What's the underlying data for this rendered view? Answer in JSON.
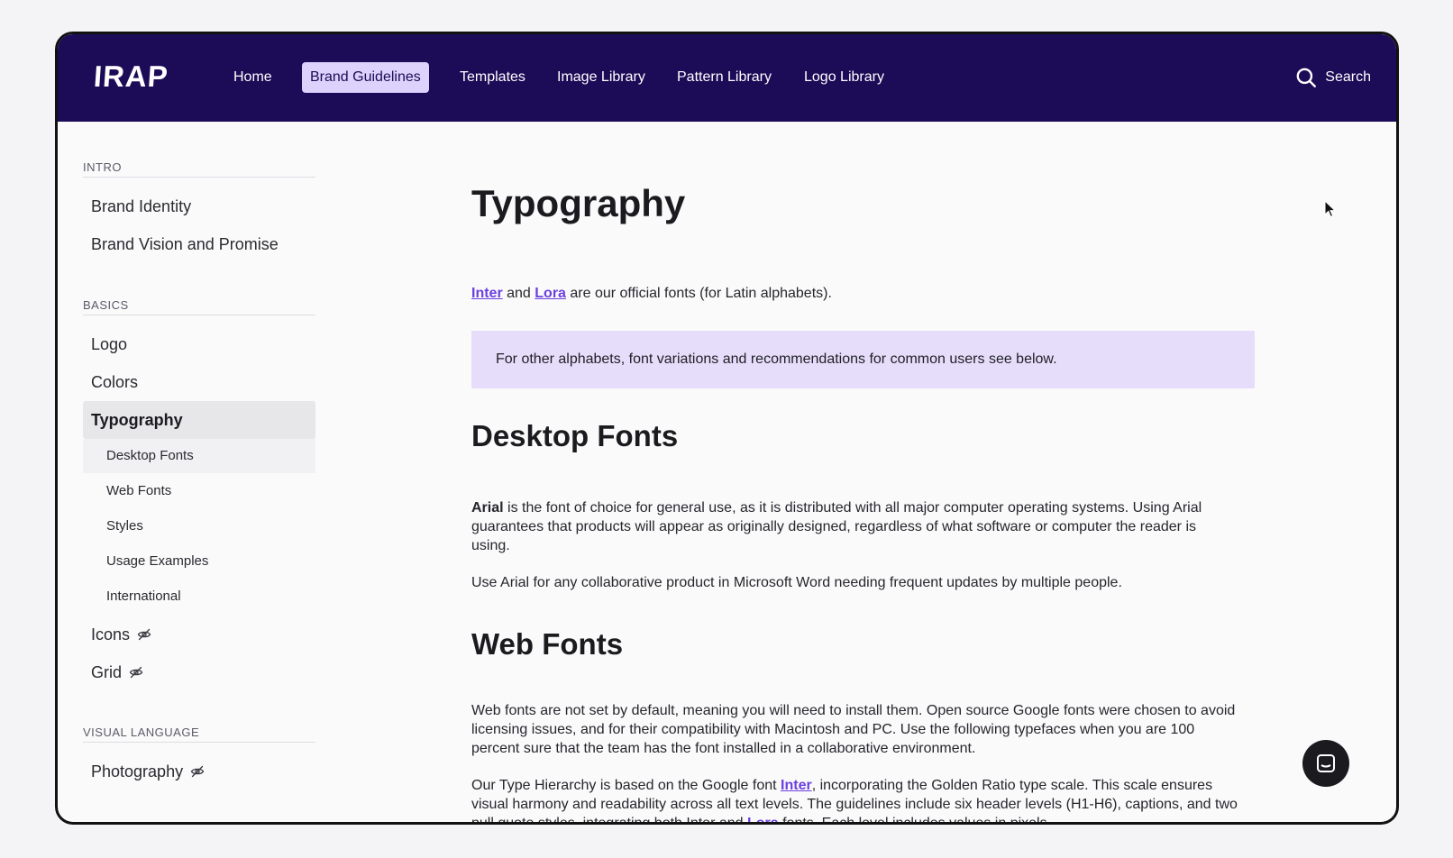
{
  "brand": {
    "logo": "IRAP"
  },
  "nav": {
    "items": [
      {
        "label": "Home",
        "active": false
      },
      {
        "label": "Brand Guidelines",
        "active": true
      },
      {
        "label": "Templates",
        "active": false
      },
      {
        "label": "Image Library",
        "active": false
      },
      {
        "label": "Pattern Library",
        "active": false
      },
      {
        "label": "Logo Library",
        "active": false
      }
    ],
    "search_label": "Search"
  },
  "sidebar": {
    "sections": [
      {
        "label": "INTRO",
        "items": [
          "Brand Identity",
          "Brand Vision and Promise"
        ]
      },
      {
        "label": "BASICS",
        "items": [
          "Logo",
          "Colors",
          "Typography"
        ],
        "subitems": [
          "Desktop Fonts",
          "Web Fonts",
          "Styles",
          "Usage Examples",
          "International"
        ],
        "more": [
          "Icons",
          "Grid"
        ]
      },
      {
        "label": "VISUAL LANGUAGE",
        "items": [
          "Photography"
        ]
      }
    ]
  },
  "content": {
    "title": "Typography",
    "intro": {
      "link1": "Inter",
      "mid": " and ",
      "link2": "Lora",
      "rest": " are our official fonts (for Latin alphabets)."
    },
    "callout": "For other alphabets, font variations and recommendations for common users see below.",
    "desktop": {
      "heading": "Desktop Fonts",
      "p1_bold": "Arial",
      "p1_rest": " is the font of choice for general use, as it is distributed with all major computer operating systems. Using Arial guarantees that products will appear as originally designed, regardless of what software or computer the reader is using.",
      "p2": "Use Arial for any collaborative product in Microsoft Word needing frequent updates by multiple people."
    },
    "web": {
      "heading": "Web Fonts",
      "p1": "Web fonts are not set by default, meaning you will need to install them. Open source Google fonts were chosen to avoid licensing issues, and for their compatibility with Macintosh and PC. Use the following typefaces when you are 100 percent sure that the team has the font installed in a collaborative environment.",
      "p2_a": "Our Type Hierarchy is based on the Google font ",
      "p2_link1": "Inter",
      "p2_b": ", incorporating the Golden Ratio type scale. This scale ensures visual harmony and readability across all text levels. The guidelines include six header levels (H1-H6), captions, and two pull quote styles, integrating both Inter and ",
      "p2_link2": "Lora",
      "p2_c": " fonts. Each level includes values in pixels"
    }
  },
  "icons": {
    "search": "search-icon",
    "hidden": "eye-slash-icon",
    "chat": "chat-icon",
    "cursor": "cursor-icon"
  },
  "colors": {
    "topbar": "#1c0b57",
    "accent": "#6b3fe0",
    "callout_bg": "#e6ddfb",
    "active_nav_bg": "#dcd2fb"
  }
}
